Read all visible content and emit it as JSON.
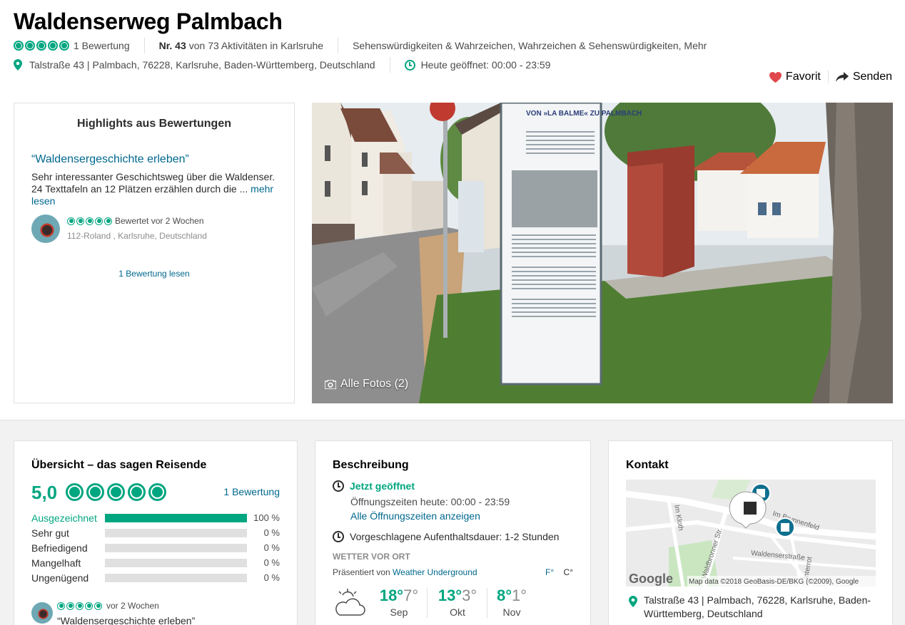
{
  "header": {
    "title": "Waldenserweg Palmbach",
    "review_count": "1 Bewertung",
    "ranking_prefix": "Nr. 43",
    "ranking_suffix": "von 73 Aktivitäten in Karlsruhe",
    "categories": "Sehenswürdigkeiten & Wahrzeichen, Wahrzeichen & Sehenswürdigkeiten, Mehr",
    "address": "Talstraße 43 | Palmbach, 76228, Karlsruhe, Baden-Württemberg, Deutschland",
    "hours": "Heute geöffnet: 00:00 - 23:59",
    "favorite_label": "Favorit",
    "share_label": "Senden"
  },
  "highlights": {
    "title": "Highlights aus Bewertungen",
    "quote": "“Waldensergeschichte erleben”",
    "text": "Sehr interessanter Geschichtsweg über die Waldenser. 24 Texttafeln an 12 Plätzen erzählen durch die ... ",
    "more": "mehr lesen",
    "reviewed": "Bewertet vor 2 Wochen",
    "reviewer_location": "112-Roland , Karlsruhe, Deutschland",
    "read_link": "1 Bewertung lesen"
  },
  "photo": {
    "all_photos": "Alle Fotos (2)",
    "sign_heading": "VON »LA BALME« ZU PALMBACH"
  },
  "overview": {
    "title": "Übersicht – das sagen Reisende",
    "score": "5,0",
    "count_link": "1 Bewertung",
    "rows": [
      {
        "label": "Ausgezeichnet",
        "pct_text": "100 %",
        "pct": 100
      },
      {
        "label": "Sehr gut",
        "pct_text": "0 %",
        "pct": 0
      },
      {
        "label": "Befriedigend",
        "pct_text": "0 %",
        "pct": 0
      },
      {
        "label": "Mangelhaft",
        "pct_text": "0 %",
        "pct": 0
      },
      {
        "label": "Ungenügend",
        "pct_text": "0 %",
        "pct": 0
      }
    ],
    "recent_time": "vor 2 Wochen",
    "recent_quote": "“Waldensergeschichte erleben”"
  },
  "description": {
    "title": "Beschreibung",
    "open_now": "Jetzt geöffnet",
    "hours_today": "Öffnungszeiten heute: 00:00 - 23:59",
    "all_hours": "Alle Öffnungszeiten anzeigen",
    "stay": "Vorgeschlagene Aufenthaltsdauer: 1-2 Stunden",
    "weather_heading": "WETTER VOR ORT",
    "presented_by": "Präsentiert von ",
    "weather_source": "Weather Underground",
    "unit_f": "F°",
    "unit_c": "C°",
    "months": [
      {
        "hi": "18°",
        "lo": "7°",
        "name": "Sep"
      },
      {
        "hi": "13°",
        "lo": "3°",
        "name": "Okt"
      },
      {
        "hi": "8°",
        "lo": "1°",
        "name": "Nov"
      }
    ]
  },
  "contact": {
    "title": "Kontakt",
    "address": "Talstraße 43 | Palmbach, 76228, Karlsruhe, Baden-Württemberg, Deutschland",
    "map": {
      "google_logo": "Google",
      "attribution": "Map data ©2018 GeoBasis-DE/BKG (©2009), Google",
      "streets": [
        "Im Brunnenfeld",
        "Im Kloth",
        "Waldbronner Str.",
        "Waldenserstraße",
        "Interrot"
      ]
    }
  },
  "colors": {
    "accent": "#00a680",
    "link": "#00688e",
    "heart": "#e0484e"
  }
}
